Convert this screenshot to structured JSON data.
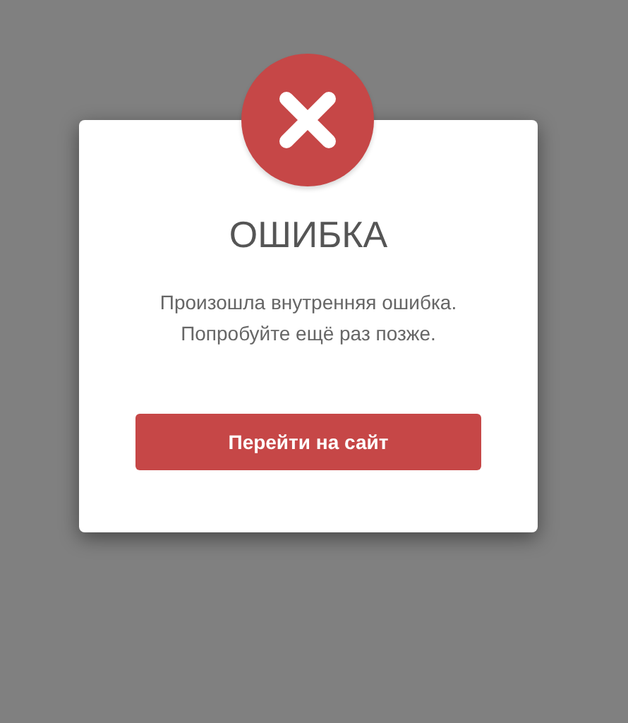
{
  "dialog": {
    "title": "ОШИБКА",
    "message": [
      "Произошла внутренняя ошибка.",
      "Попробуйте ещё раз позже."
    ],
    "button": "Перейти на сайт"
  }
}
